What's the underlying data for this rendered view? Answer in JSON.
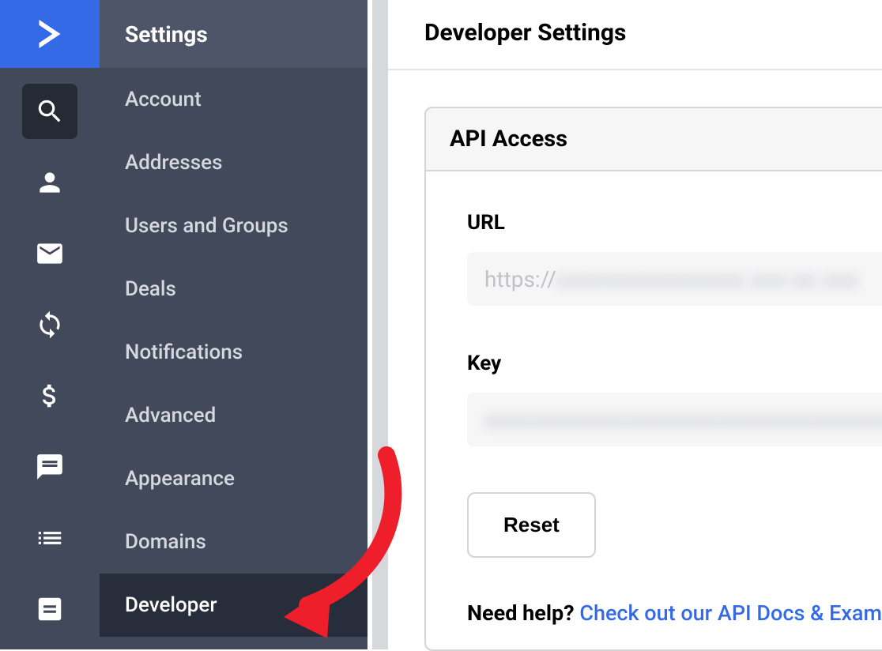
{
  "settings_header": "Settings",
  "sidebar_items": [
    {
      "label": "Account"
    },
    {
      "label": "Addresses"
    },
    {
      "label": "Users and Groups"
    },
    {
      "label": "Deals"
    },
    {
      "label": "Notifications"
    },
    {
      "label": "Advanced"
    },
    {
      "label": "Appearance"
    },
    {
      "label": "Domains"
    },
    {
      "label": "Developer",
      "active": true
    }
  ],
  "page_title": "Developer Settings",
  "api_access": {
    "header": "API Access",
    "url_label": "URL",
    "url_prefix": "https://",
    "url_hidden": "xxxxxxxxxxxxxxxx.xxx-xx.xxx",
    "key_label": "Key",
    "key_hidden": "xxxxxxxxxxxxxxxxxxxxxxxxxxxxxxxxxxxxx",
    "reset_button": "Reset",
    "help_prefix": "Need help? ",
    "help_link": "Check out our API Docs & Exam"
  }
}
